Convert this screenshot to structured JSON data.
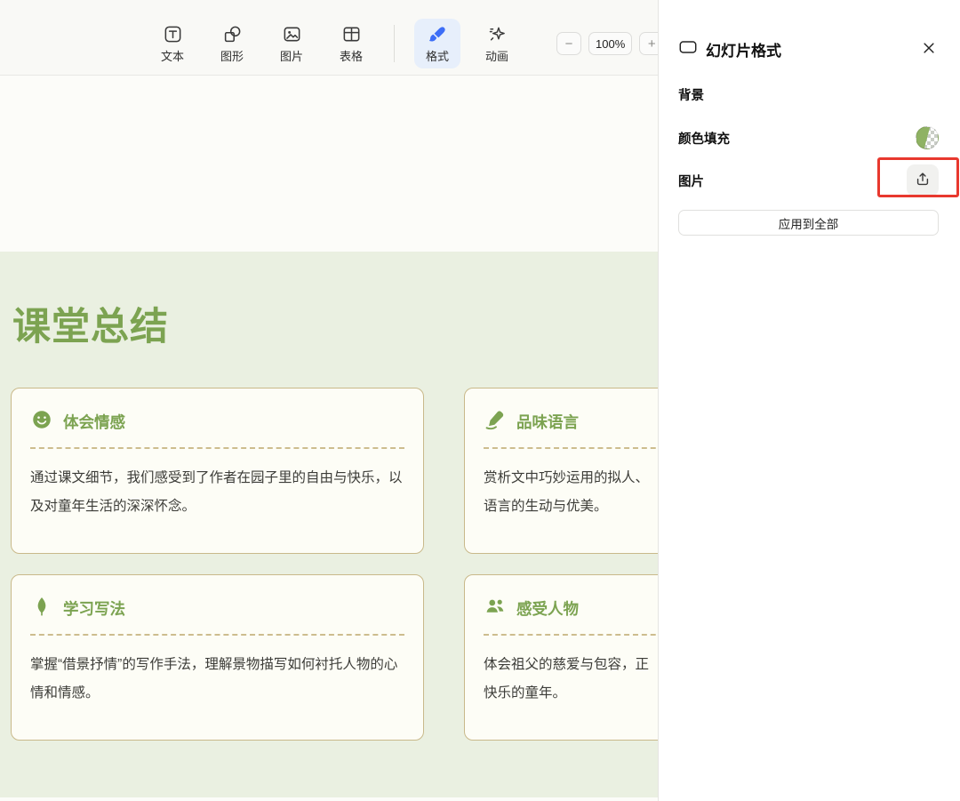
{
  "toolbar": {
    "tools": [
      {
        "label": "文本",
        "icon": "text-icon"
      },
      {
        "label": "图形",
        "icon": "shapes-icon"
      },
      {
        "label": "图片",
        "icon": "image-icon"
      },
      {
        "label": "表格",
        "icon": "table-icon"
      },
      {
        "label": "格式",
        "icon": "format-brush-icon",
        "active": true
      },
      {
        "label": "动画",
        "icon": "animation-sparkle-icon"
      }
    ],
    "zoom": {
      "minus": "−",
      "level": "100%",
      "plus": "+"
    }
  },
  "slide": {
    "title": "课堂总结",
    "cards": [
      {
        "title": "体会情感",
        "icon": "smiley-icon",
        "body": "通过课文细节，我们感受到了作者在园子里的自由与快乐，以及对童年生活的深深怀念。"
      },
      {
        "title": "品味语言",
        "icon": "pen-icon",
        "body": "赏析文中巧妙运用的拟人、\n语言的生动与优美。"
      },
      {
        "title": "学习写法",
        "icon": "leaf-icon",
        "body": "掌握“借景抒情”的写作手法，理解景物描写如何衬托人物的心情和情感。"
      },
      {
        "title": "感受人物",
        "icon": "people-icon",
        "body": "体会祖父的慈爱与包容，正\n快乐的童年。"
      }
    ]
  },
  "panel": {
    "title": "幻灯片格式",
    "background_label": "背景",
    "color_fill_label": "颜色填充",
    "image_label": "图片",
    "apply_all_label": "应用到全部"
  },
  "colors": {
    "accent_green": "#7CA351",
    "slide_background": "#EAF0E1",
    "card_background": "#FDFDF6",
    "card_border": "#C9B98A",
    "active_tool_background": "#E7EFFB",
    "active_tool_icon": "#3D6EF7",
    "annotation_red": "#E8382E"
  }
}
